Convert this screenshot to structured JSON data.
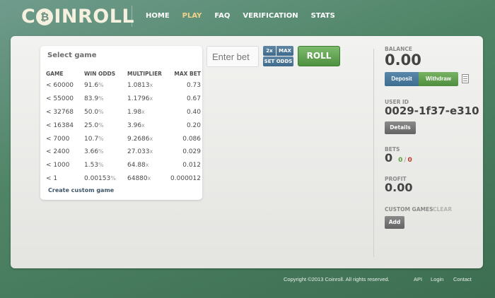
{
  "header": {
    "logo_prefix": "C",
    "logo_coin": "₿",
    "logo_mid": "IN",
    "logo_suffix": "ROLL",
    "nav": [
      "HOME",
      "PLAY",
      "FAQ",
      "VERIFICATION",
      "STATS"
    ],
    "active_nav": "PLAY",
    "active_color": "#f1d28a"
  },
  "games": {
    "title": "Select game",
    "columns": [
      "GAME",
      "WIN ODDS",
      "MULTIPLIER",
      "MAX BET"
    ],
    "rows": [
      {
        "game": "< 60000",
        "odds": "91.6",
        "mult": "1.0813",
        "max": "0.73"
      },
      {
        "game": "< 55000",
        "odds": "83.9",
        "mult": "1.1796",
        "max": "0.67"
      },
      {
        "game": "< 32768",
        "odds": "50.0",
        "mult": "1.98",
        "max": "0.40"
      },
      {
        "game": "< 16384",
        "odds": "25.0",
        "mult": "3.96",
        "max": "0.20"
      },
      {
        "game": "< 7000",
        "odds": "10.7",
        "mult": "9.2686",
        "max": "0.086"
      },
      {
        "game": "< 2400",
        "odds": "3.66",
        "mult": "27.033",
        "max": "0.029"
      },
      {
        "game": "< 1000",
        "odds": "1.53",
        "mult": "64.88",
        "max": "0.012"
      },
      {
        "game": "< 1",
        "odds": "0.00153",
        "mult": "64880",
        "max": "0.000012"
      }
    ],
    "percent_unit": "%",
    "mult_unit": "x",
    "create_custom": "Create custom game"
  },
  "bet": {
    "placeholder": "Enter bet",
    "double_label": "2x",
    "max_label": "MAX",
    "set_odds_label": "SET ODDS",
    "roll_label": "ROLL"
  },
  "account": {
    "balance_label": "BALANCE",
    "balance_value": "0.00",
    "deposit_label": "Deposit",
    "withdraw_label": "Withdraw",
    "user_id_label": "USER ID",
    "user_id_value": "0029-1f37-e310",
    "details_label": "Details",
    "bets_label": "BETS",
    "bets_total": "0",
    "bets_won": "0",
    "bets_sep": "/",
    "bets_lost": "0",
    "won_color": "#5aa03f",
    "lost_color": "#c0392b",
    "profit_label": "PROFIT",
    "profit_value": "0.00",
    "custom_games_label": "CUSTOM GAMES",
    "clear_label": "CLEAR",
    "add_label": "Add"
  },
  "footer": {
    "copyright": "Copyright ©2013 Coinroll. All rights reserved.",
    "links": [
      "API",
      "Login",
      "Contact"
    ]
  }
}
